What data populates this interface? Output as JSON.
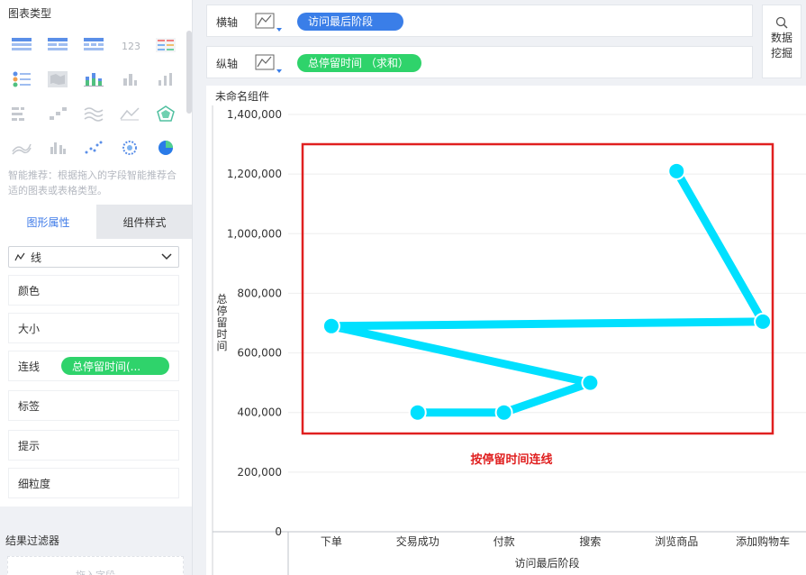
{
  "left_panel": {
    "title": "图表类型",
    "hint": "智能推荐：根据拖入的字段智能推荐合适的图表或表格类型。",
    "tabs": {
      "shape": "图形属性",
      "style": "组件样式"
    },
    "shape_select": "线",
    "props": [
      {
        "label": "颜色"
      },
      {
        "label": "大小"
      },
      {
        "label": "连线",
        "pill": "总停留时间(..."
      },
      {
        "label": "标签"
      },
      {
        "label": "提示"
      },
      {
        "label": "细粒度"
      }
    ],
    "filter_title": "结果过滤器",
    "drop_placeholder": "拖入字段",
    "colors": {
      "accent": "#3f7be8",
      "green": "#2fd36b"
    }
  },
  "x_axis_bar": {
    "label": "横轴",
    "icon": "line-chart-icon",
    "pill": "访问最后阶段"
  },
  "y_axis_bar": {
    "label": "纵轴",
    "icon": "line-chart-icon",
    "pill": "总停留时间 （求和）"
  },
  "mining_button": {
    "line1": "数据",
    "line2": "挖掘",
    "icon": "mining-icon"
  },
  "component_title": "未命名组件",
  "annotation": {
    "text": "按停留时间连线",
    "color": "#e02020"
  },
  "chart_data": {
    "type": "line",
    "categories": [
      "下单",
      "交易成功",
      "付款",
      "搜索",
      "浏览商品",
      "添加购物车"
    ],
    "xlabel": "访问最后阶段",
    "ylabel": "总停留时间",
    "ylim": [
      0,
      1400000
    ],
    "yticks": [
      0,
      200000,
      400000,
      600000,
      800000,
      1000000,
      1200000,
      1400000
    ],
    "ytick_labels": [
      "0",
      "200,000",
      "400,000",
      "600,000",
      "800,000",
      "1,000,000",
      "1,200,000",
      "1,400,000"
    ],
    "series": [
      {
        "color": "#00e0ff",
        "points": [
          {
            "x": "交易成功",
            "y": 400000
          },
          {
            "x": "付款",
            "y": 400000
          },
          {
            "x": "搜索",
            "y": 500000
          },
          {
            "x": "下单",
            "y": 690000
          },
          {
            "x": "添加购物车",
            "y": 705000
          },
          {
            "x": "浏览商品",
            "y": 1210000
          }
        ]
      }
    ],
    "grid": true
  }
}
